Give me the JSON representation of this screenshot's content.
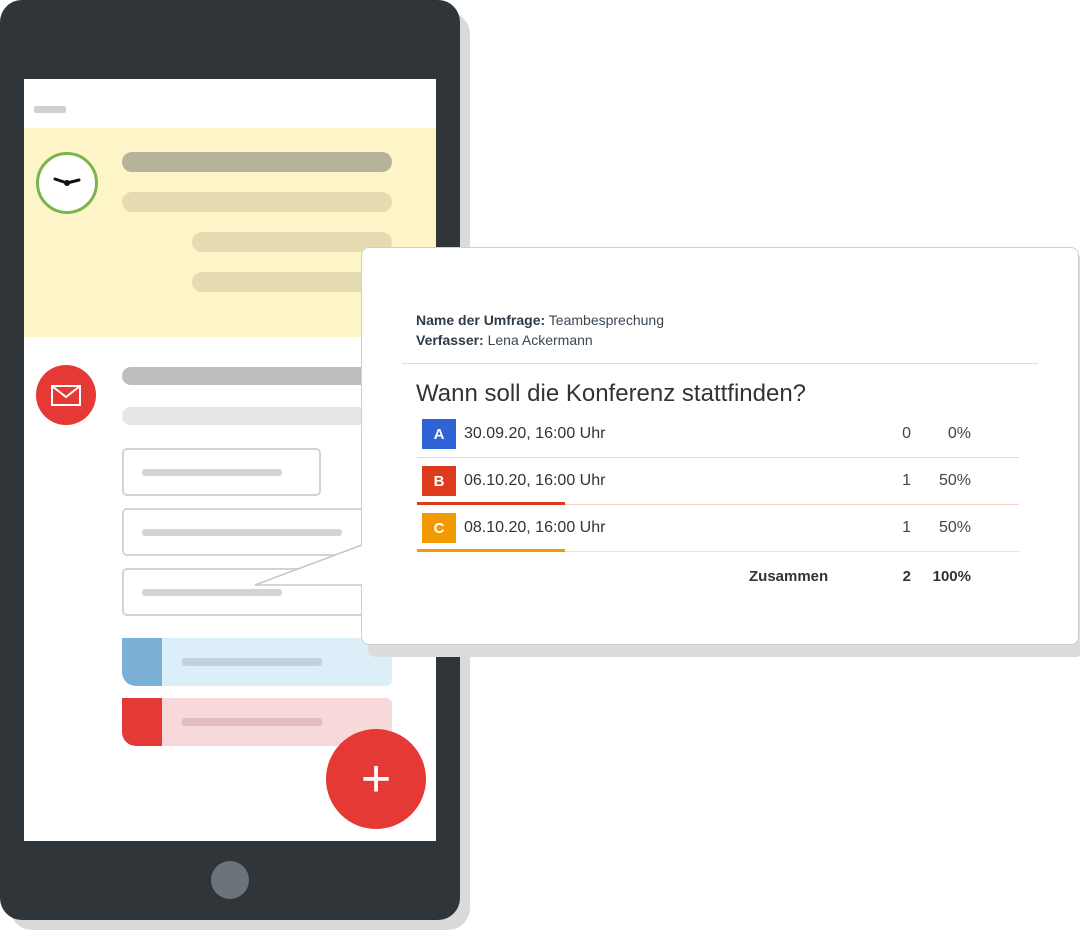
{
  "survey": {
    "name_label": "Name der Umfrage:",
    "name_value": "Teambesprechung",
    "author_label": "Verfasser:",
    "author_value": "Lena Ackermann",
    "question": "Wann soll die Konferenz stattfinden?",
    "options": [
      {
        "letter": "A",
        "label": "30.09.20, 16:00 Uhr",
        "count": "0",
        "percent": "0%",
        "share": 0,
        "color": "#2f63d6",
        "line_color": "#cfdbe9"
      },
      {
        "letter": "B",
        "label": "06.10.20, 16:00 Uhr",
        "count": "1",
        "percent": "50%",
        "share": 0.5,
        "color": "#dd3b1b",
        "line_color": "#f6cfc7"
      },
      {
        "letter": "C",
        "label": "08.10.20, 16:00 Uhr",
        "count": "1",
        "percent": "50%",
        "share": 0.5,
        "color": "#f29b00",
        "line_color": "#f9e0b6"
      }
    ],
    "total_label": "Zusammen",
    "total_count": "2",
    "total_percent": "100%"
  },
  "app": {
    "fab_icon": "plus-icon",
    "fab_symbol": "+",
    "clock_icon": "clock-icon",
    "mail_icon": "mail-icon"
  },
  "colors": {
    "device": "#2f3538",
    "fab": "#e53935",
    "highlight_panel": "#fdf4c8",
    "clock_ring": "#7bb54a"
  }
}
